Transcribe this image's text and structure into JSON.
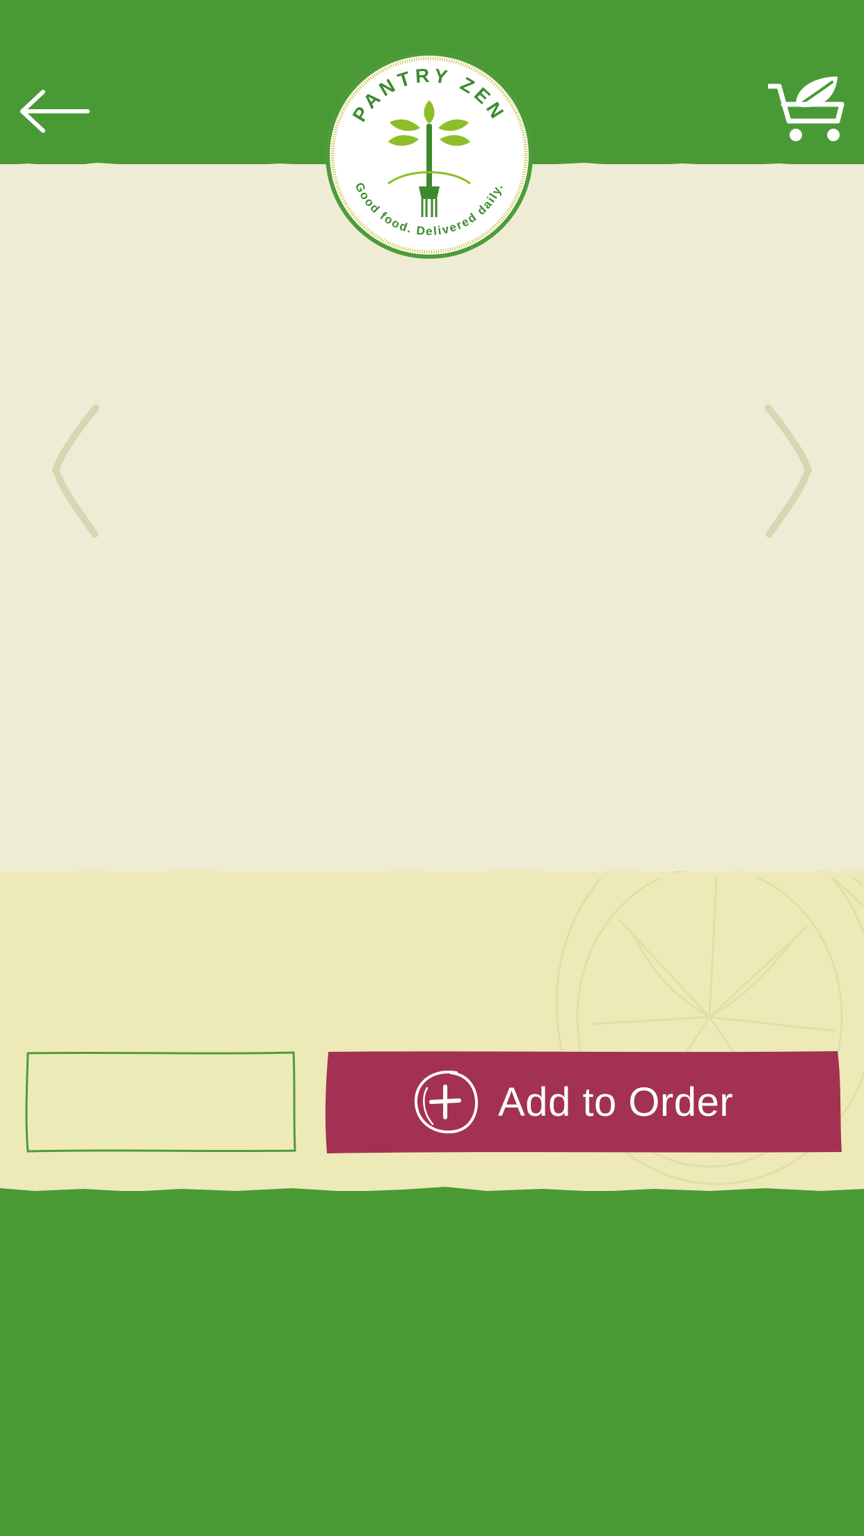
{
  "brand": {
    "name": "PANTRY ZEN",
    "tagline": "Good food. Delivered daily."
  },
  "actions": {
    "add_to_order_label": "Add to Order",
    "quantity_value": ""
  },
  "icons": {
    "back": "arrow-left-icon",
    "cart": "leaf-cart-icon",
    "prev": "chevron-left-icon",
    "next": "chevron-right-icon",
    "add": "plus-circle-icon",
    "watermark": "lemon-sketch-icon"
  },
  "colors": {
    "brand_green": "#499a35",
    "cream": "#eeecd4",
    "pale_yellow": "#eeeab8",
    "add_button": "#a33252",
    "logo_leaf": "#8cbf27"
  }
}
